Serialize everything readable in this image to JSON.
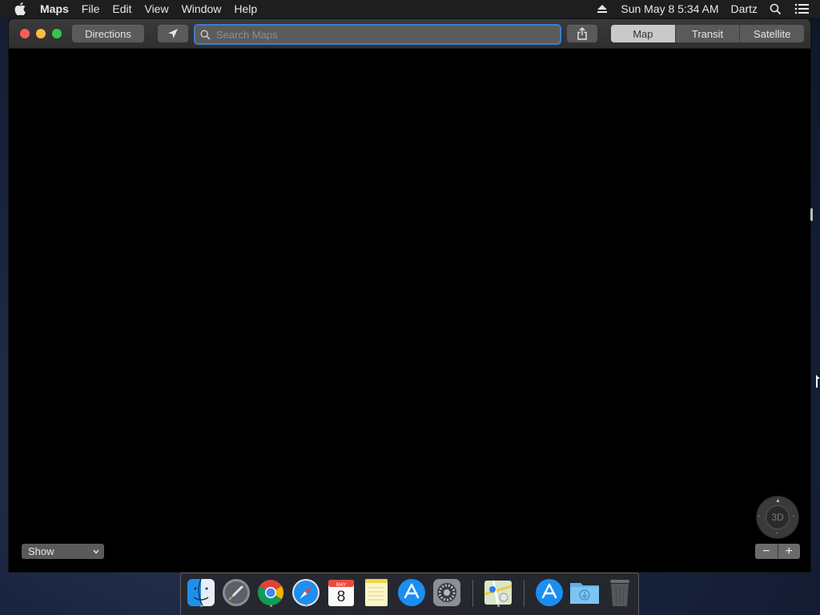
{
  "menubar": {
    "app_name": "Maps",
    "menus": [
      "File",
      "Edit",
      "View",
      "Window",
      "Help"
    ],
    "datetime": "Sun May 8  5:34 AM",
    "user": "Dartz"
  },
  "toolbar": {
    "directions_label": "Directions",
    "search_placeholder": "Search Maps",
    "search_value": "",
    "map_modes": [
      "Map",
      "Transit",
      "Satellite"
    ],
    "active_mode": "Map"
  },
  "map": {
    "show_select": "Show",
    "compass_label": "3D",
    "zoom_out": "−",
    "zoom_in": "+"
  },
  "dock": {
    "apps": [
      {
        "icon": "finder-icon",
        "running": true
      },
      {
        "icon": "launchpad-icon",
        "running": false
      },
      {
        "icon": "chrome-icon",
        "running": true
      },
      {
        "icon": "safari-icon",
        "running": true
      },
      {
        "icon": "calendar-icon",
        "running": false
      },
      {
        "icon": "notes-icon",
        "running": false
      },
      {
        "icon": "app-store-icon",
        "running": false
      },
      {
        "icon": "system-preferences-icon",
        "running": false
      },
      {
        "icon": "maps-icon",
        "running": true
      },
      {
        "icon": "app-store-downloads-icon",
        "running": false
      },
      {
        "icon": "downloads-folder-icon",
        "running": false
      },
      {
        "icon": "trash-icon",
        "running": false
      }
    ],
    "calendar_month": "MAY",
    "calendar_day": "8"
  },
  "colors": {
    "search_focus_ring": "#3a7fd0",
    "close": "#fc5d57",
    "minimize": "#fdbc40",
    "maximize": "#34c84a"
  }
}
